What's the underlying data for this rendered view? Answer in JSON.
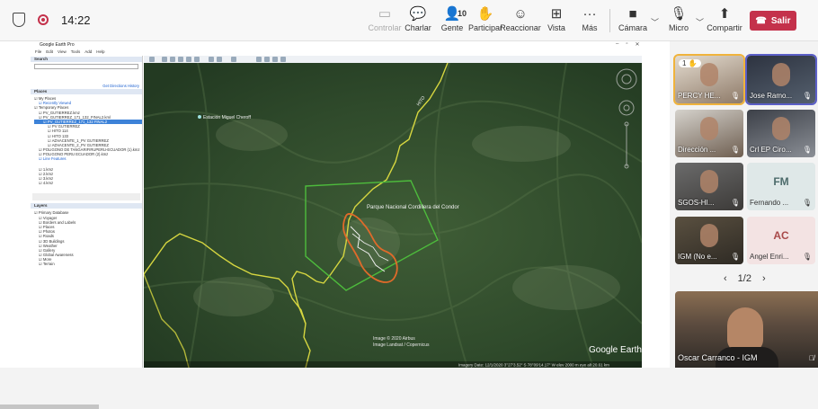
{
  "meeting": {
    "time": "14:22",
    "toolbar": {
      "controlar": "Controlar",
      "charlar": "Charlar",
      "gente": "Gente",
      "gente_count": "10",
      "participar": "Participar",
      "reaccionar": "Reaccionar",
      "vista": "Vista",
      "mas": "Más",
      "camara": "Cámara",
      "micro": "Micro",
      "compartir": "Compartir",
      "salir": "Salir"
    },
    "colors": {
      "leave": "#c4314b",
      "raise_hand": "#f0b33c",
      "accent": "#5b5fc7"
    },
    "participants": [
      {
        "name": "PERCY HE...",
        "hand": "1",
        "style": "video"
      },
      {
        "name": "Jose Ramo...",
        "style": "video"
      },
      {
        "name": "Dirección ...",
        "style": "video"
      },
      {
        "name": "Crl EP Ciro...",
        "style": "video"
      },
      {
        "name": "SGOS-HI...",
        "style": "video"
      },
      {
        "name": "Fernando ...",
        "initials": "FM",
        "style": "avatar"
      },
      {
        "name": "IGM (No e...",
        "style": "video"
      },
      {
        "name": "Angel Enri...",
        "initials": "AC",
        "style": "avatar"
      }
    ],
    "pager": "1/2",
    "spotlight": {
      "name": "Oscar Carranco - IGM"
    }
  },
  "google_earth": {
    "title": "Google Earth Pro",
    "menu": [
      "File",
      "Edit",
      "View",
      "Tools",
      "Add",
      "Help"
    ],
    "search_header": "Search",
    "get_directions": "Get Directions",
    "history": "History",
    "places_header": "Places",
    "places_items": [
      "My Places",
      "Recently Viewed",
      "Temporary Places",
      "PV_GUTIERREZ.kmz",
      "PV_GUTIERREZ_171_132_FINAL2.kml",
      "PV_GUTIERREZ_171_132 FINAL2",
      "PV GUTIERREZ",
      "HITO 114",
      "HITO 133",
      "ADVACENTE_1_PV GUTIERREZ",
      "ADVACENTE_2_PV GUTIERREZ",
      "POLIGONO DE TANGARIFIRUPERU-ECUADOR (1).kmz",
      "POLIGONO PERU ECUADOR (2).kmz",
      "Line Features",
      "1.kmz",
      "2.kmz",
      "3.kmz",
      "4.kmz"
    ],
    "layers_header": "Layers",
    "layers_items": [
      "Primary Database",
      "Voyager",
      "Borders and Labels",
      "Places",
      "Photos",
      "Roads",
      "3D Buildings",
      "Weather",
      "Gallery",
      "Global Awareness",
      "More",
      "Terrain"
    ],
    "map": {
      "label_park": "Parque Nacional Cordillera del Condor",
      "label_station": "Estación Miguel Cheroff",
      "label_hito": "HITO",
      "imagery_credit": "Image © 2020 Airbus",
      "landsat_credit": "Image Landsat / Copernicus",
      "logo": "Google Earth",
      "status": "Imagery Date: 12/1/2020   3°27'3.52\" S   78°09'14.17\" W   elev 2000 m   eye alt 20.61 km"
    }
  }
}
